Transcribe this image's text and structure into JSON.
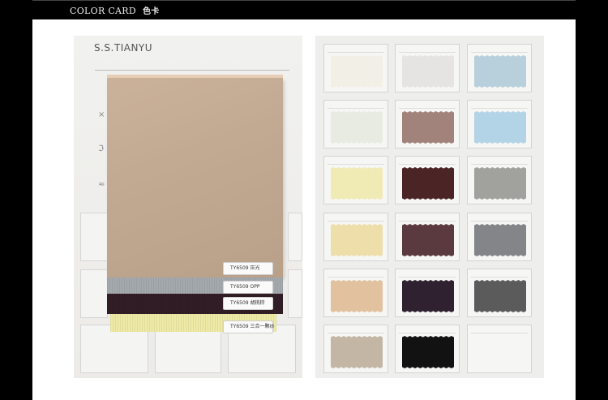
{
  "header": {
    "title": "COLOR CARD",
    "title_cn": "色卡"
  },
  "left_card": {
    "brand": "S.S.TIANYU",
    "tags": [
      "TY6509  压光",
      "TY6509  OPP",
      "TY6509  胡桃棕",
      "TY6509 三合一颗纱"
    ],
    "strip_colors": {
      "main": "#c2aa92",
      "blue": "#a4a9ad",
      "plum": "#311d25",
      "yellow": "#eeeaa6"
    }
  },
  "right_card": {
    "swatches": [
      {
        "color": "#f2efe6"
      },
      {
        "color": "#e6e4e2"
      },
      {
        "color": "#b7d0db"
      },
      {
        "color": "#e8ebe2"
      },
      {
        "color": "#a1837c"
      },
      {
        "color": "#b3d3e6"
      },
      {
        "color": "#f0eab5"
      },
      {
        "color": "#4b2525"
      },
      {
        "color": "#a1a29d"
      },
      {
        "color": "#eedeaa"
      },
      {
        "color": "#5a3a3e"
      },
      {
        "color": "#848588"
      },
      {
        "color": "#e2c19f"
      },
      {
        "color": "#2f2130"
      },
      {
        "color": "#5b5b5b"
      },
      {
        "color": "#c3b6a5"
      },
      {
        "color": "#121212"
      },
      {
        "color": ""
      }
    ]
  }
}
